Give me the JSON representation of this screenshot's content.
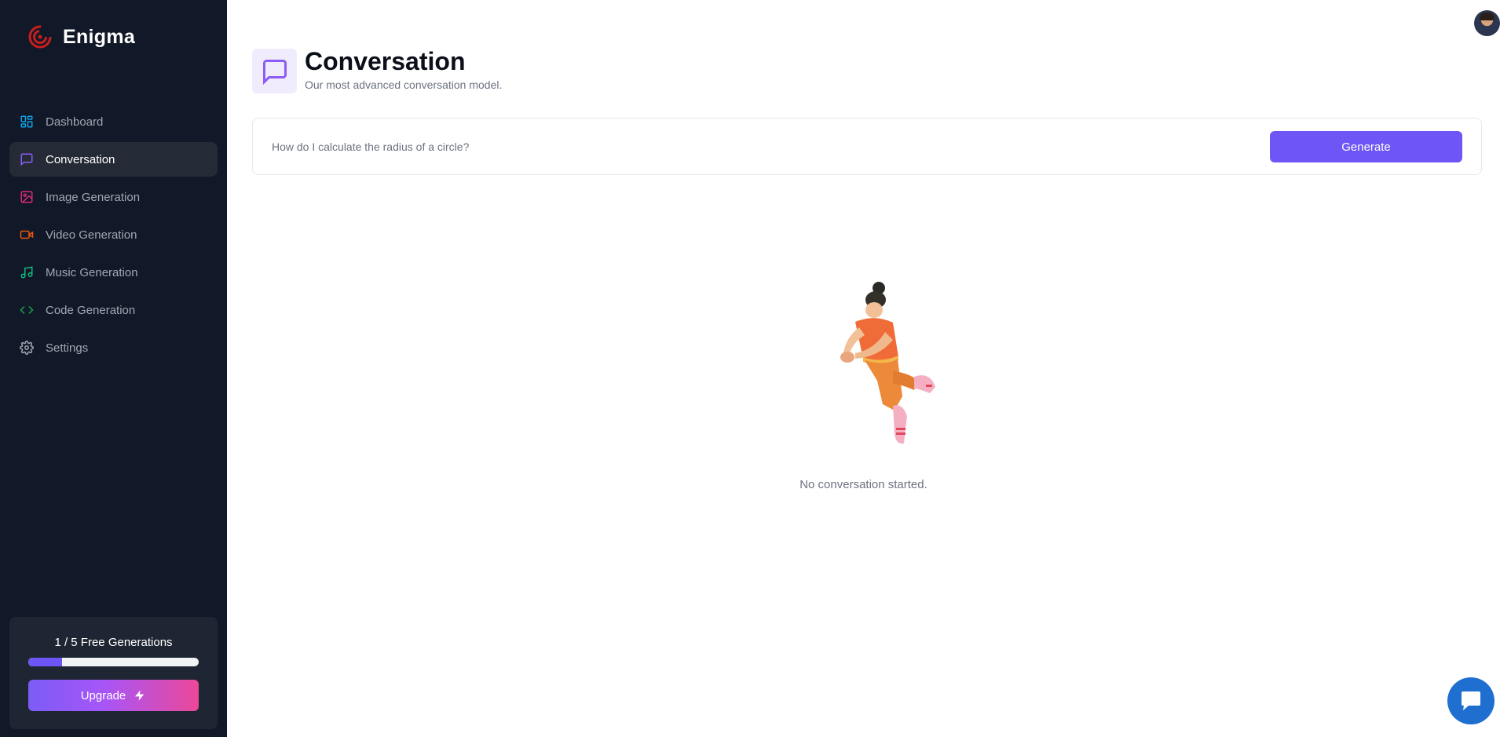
{
  "brand": {
    "name": "Enigma"
  },
  "sidebar": {
    "items": [
      {
        "label": "Dashboard",
        "icon": "dashboard-icon",
        "color": "#0ea5e9"
      },
      {
        "label": "Conversation",
        "icon": "message-square-icon",
        "color": "#8b5cf6",
        "active": true
      },
      {
        "label": "Image Generation",
        "icon": "image-icon",
        "color": "#db2777"
      },
      {
        "label": "Video Generation",
        "icon": "video-icon",
        "color": "#ea580c"
      },
      {
        "label": "Music Generation",
        "icon": "music-icon",
        "color": "#10b981"
      },
      {
        "label": "Code Generation",
        "icon": "code-icon",
        "color": "#16a34a"
      },
      {
        "label": "Settings",
        "icon": "gear-icon",
        "color": "#a1a8b3"
      }
    ],
    "usage": {
      "text": "1 / 5 Free Generations",
      "used": 1,
      "limit": 5,
      "progress_fraction": 0.2
    },
    "upgrade": {
      "label": "Upgrade",
      "icon": "zap-icon"
    }
  },
  "header": {
    "title": "Conversation",
    "subtitle": "Our most advanced conversation model.",
    "icon": "message-square-icon",
    "accent": "#8b5cf6"
  },
  "prompt": {
    "placeholder": "How do I calculate the radius of a circle?",
    "value": "",
    "button_label": "Generate"
  },
  "empty_state": {
    "text": "No conversation started."
  },
  "colors": {
    "sidebar_bg": "#111827",
    "primary": "#6d56f5",
    "chat_widget": "#1f6fd1"
  }
}
